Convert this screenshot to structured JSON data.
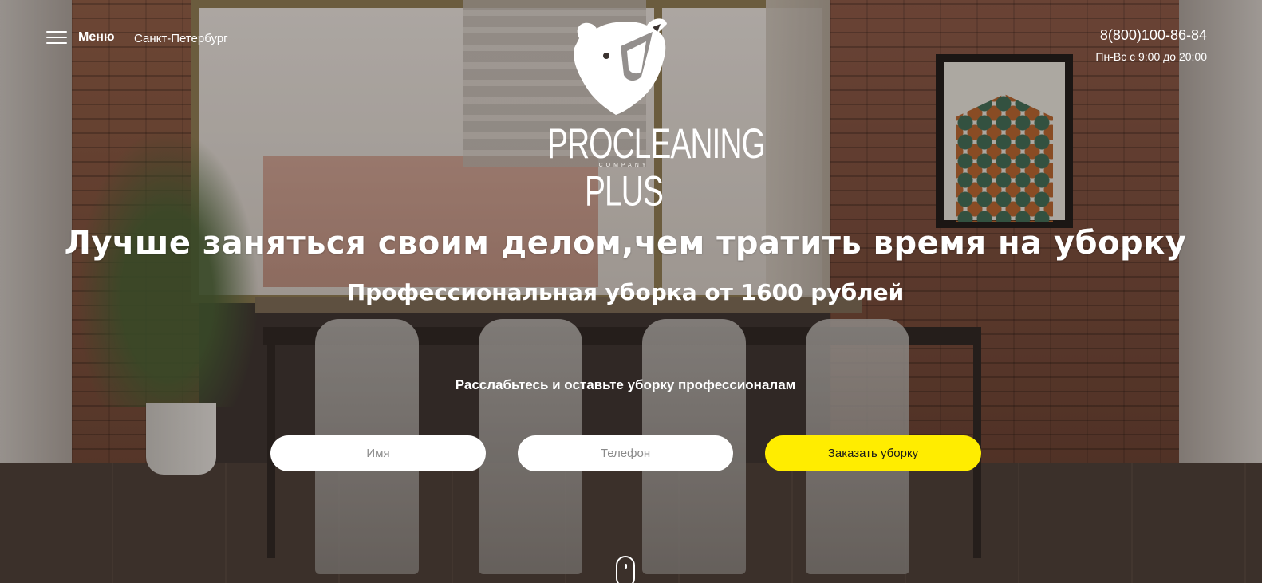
{
  "header": {
    "menu_label": "Меню",
    "city": "Санкт-Петербург",
    "phone": "8(800)100-86-84",
    "hours": "Пн-Вс с 9:00 до 20:00"
  },
  "logo": {
    "name": "PROCLEANING PLUS",
    "sub": "COMPANY",
    "icon": "roaring-bear-icon"
  },
  "hero": {
    "headline": "Лучше заняться своим делом,чем тратить время на уборку",
    "subheadline": "Профессиональная уборка от 1600 рублей",
    "tagline": "Расслабьтесь и оставьте уборку профессионалам"
  },
  "form": {
    "name_placeholder": "Имя",
    "phone_placeholder": "Телефон",
    "submit_label": "Заказать уборку"
  },
  "colors": {
    "accent": "#ffed00",
    "text": "#ffffff"
  },
  "icons": {
    "menu": "hamburger-icon",
    "scroll": "scroll-mouse-icon"
  }
}
